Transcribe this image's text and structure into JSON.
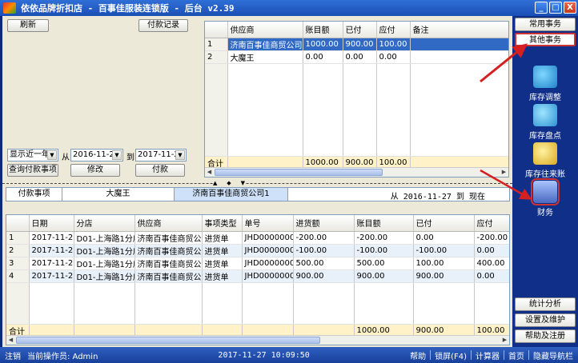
{
  "window": {
    "title": "依依品牌折扣店 - 百事佳服装连锁版 - 后台 v2.39",
    "buttons": [
      "_",
      "□",
      "X"
    ]
  },
  "top_left": {
    "refresh_label": "刷新",
    "payment_record_label": "付款记录",
    "period_value": "显示近一年",
    "from_label": "从",
    "date_from": "2016-11-27",
    "to_label": "到",
    "date_to": "2017-11-27",
    "query_label": "查询付款事项",
    "edit_label": "修改",
    "pay_label": "付款"
  },
  "supplier_grid": {
    "columns": [
      "供应商",
      "账目额",
      "已付",
      "应付",
      "备注"
    ],
    "rows": [
      {
        "n": "1",
        "supplier": "济南百事佳商贸公司1",
        "amount": "1000.00",
        "paid": "900.00",
        "due": "100.00",
        "note": ""
      },
      {
        "n": "2",
        "supplier": "大魔王",
        "amount": "0.00",
        "paid": "0.00",
        "due": "0.00",
        "note": ""
      }
    ],
    "total": {
      "label": "合计",
      "amount": "1000.00",
      "paid": "900.00",
      "due": "100.00"
    }
  },
  "tabs": {
    "items": [
      "付款事项",
      "大魔王",
      "济南百事佳商贸公司1"
    ],
    "date_range": "从 2016-11-27 到 现在"
  },
  "detail_grid": {
    "columns": [
      "日期",
      "分店",
      "供应商",
      "事项类型",
      "单号",
      "进货额",
      "账目额",
      "已付",
      "应付"
    ],
    "rows": [
      {
        "n": "1",
        "date": "2017-11-22",
        "store": "D01-上海路1分店",
        "supplier": "济南百事佳商贸公司",
        "type": "进货单",
        "no": "JHD00000005",
        "purchase": "-200.00",
        "amount": "-200.00",
        "paid": "0.00",
        "due": "-200.00"
      },
      {
        "n": "2",
        "date": "2017-11-22",
        "store": "D01-上海路1分店",
        "supplier": "济南百事佳商贸公司",
        "type": "进货单",
        "no": "JHD00000004",
        "purchase": "-100.00",
        "amount": "-100.00",
        "paid": "-100.00",
        "due": "0.00"
      },
      {
        "n": "3",
        "date": "2017-11-22",
        "store": "D01-上海路1分店",
        "supplier": "济南百事佳商贸公司",
        "type": "进货单",
        "no": "JHD00000003",
        "purchase": "500.00",
        "amount": "500.00",
        "paid": "100.00",
        "due": "400.00"
      },
      {
        "n": "4",
        "date": "2017-11-22",
        "store": "D01-上海路1分店",
        "supplier": "济南百事佳商贸公司",
        "type": "进货单",
        "no": "JHD00000002",
        "purchase": "900.00",
        "amount": "900.00",
        "paid": "900.00",
        "due": "0.00"
      }
    ],
    "total": {
      "label": "合计",
      "amount": "1000.00",
      "paid": "900.00",
      "due": "100.00"
    }
  },
  "right_panel": {
    "common_label": "常用事务",
    "other_label": "其他事务",
    "icons": [
      {
        "label": "库存调整",
        "icon": "inventory-adjust-icon",
        "color": "#2fa0e0"
      },
      {
        "label": "库存盘点",
        "icon": "stocktake-icon",
        "color": "#3ab0e8"
      },
      {
        "label": "库存往来账",
        "icon": "inventory-ledger-icon",
        "color": "#e8c030"
      },
      {
        "label": "财务",
        "icon": "finance-icon",
        "color": "#5070c0"
      }
    ],
    "stats_label": "统计分析",
    "settings_label": "设置及维护",
    "help_label": "帮助及注册"
  },
  "status_bar": {
    "logout": "注销",
    "operator": "当前操作员: Admin",
    "datetime": "2017-11-27 10:09:50",
    "help": "帮助",
    "lock": "锁屏(F4)",
    "calculator": "计算器",
    "home": "首页",
    "hide_nav": "隐藏导航栏"
  },
  "colors": {
    "annotation_arrow": "#d42020",
    "selected_row": "#316ac5",
    "total_row": "#fff2c8"
  }
}
